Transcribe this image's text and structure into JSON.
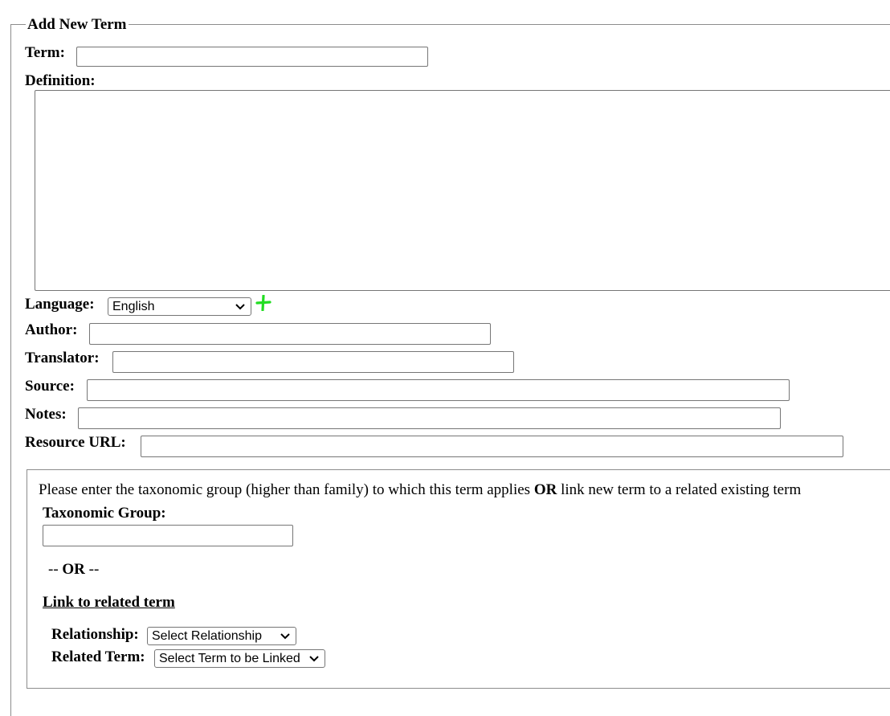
{
  "form": {
    "legend": "Add New Term",
    "term_label": "Term:",
    "term_value": "",
    "definition_label": "Definition:",
    "definition_value": "",
    "language_label": "Language:",
    "language_selected": "English",
    "add_language_icon": "plus-icon",
    "author_label": "Author:",
    "author_value": "",
    "translator_label": "Translator:",
    "translator_value": "",
    "source_label": "Source:",
    "source_value": "",
    "notes_label": "Notes:",
    "notes_value": "",
    "resource_url_label": "Resource URL:",
    "resource_url_value": ""
  },
  "taxonomy": {
    "instruction_start": "Please enter the taxonomic group (higher than family) to which this term applies ",
    "instruction_or": "OR",
    "instruction_end": " link new term to a related existing term",
    "taxonomic_group_label": "Taxonomic Group:",
    "taxonomic_group_value": "",
    "or_prefix": "-- ",
    "or_word": "OR",
    "or_suffix": " --",
    "link_related_label": "Link to related term",
    "relationship_label": "Relationship:",
    "relationship_selected": "Select Relationship",
    "related_term_label": "Related Term:",
    "related_term_selected": "Select Term to be Linked"
  },
  "colors": {
    "plus_icon": "#22dd22",
    "border": "#767676"
  }
}
